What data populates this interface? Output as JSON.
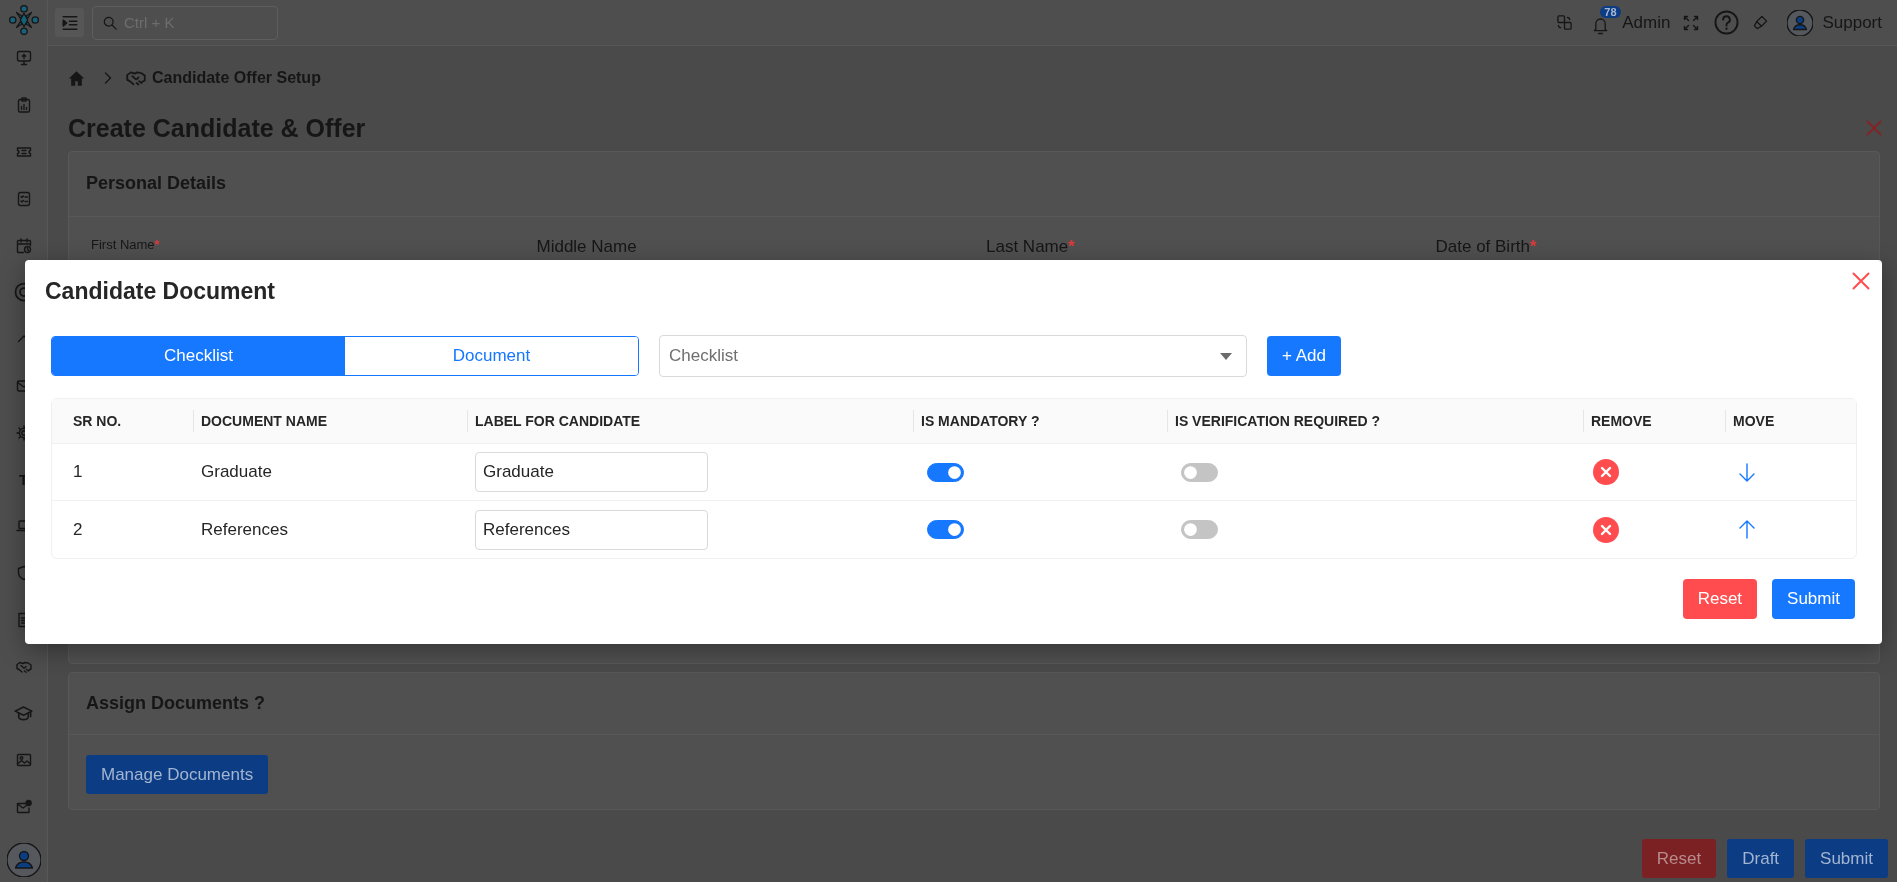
{
  "sidebar": {
    "items": [
      {
        "kind": "icon"
      },
      {
        "kind": "icon"
      },
      {
        "kind": "icon"
      },
      {
        "kind": "icon"
      },
      {
        "kind": "icon"
      },
      {
        "kind": "icon"
      },
      {
        "kind": "icon"
      },
      {
        "kind": "icon"
      },
      {
        "kind": "icon"
      },
      {
        "kind": "letter",
        "text": "T"
      },
      {
        "kind": "icon"
      },
      {
        "kind": "icon"
      },
      {
        "kind": "icon"
      },
      {
        "kind": "icon"
      },
      {
        "kind": "icon"
      },
      {
        "kind": "icon"
      },
      {
        "kind": "icon"
      }
    ]
  },
  "topbar": {
    "search": {
      "placeholder": "Ctrl + K"
    },
    "notification_count": "78",
    "role": "Admin",
    "user": "Support"
  },
  "breadcrumb": {
    "current": "Candidate Offer Setup"
  },
  "page": {
    "title": "Create Candidate & Offer"
  },
  "sections": [
    {
      "title": "Personal Details",
      "fields": [
        {
          "label": "First Name",
          "mark": "*",
          "focused": true
        },
        {
          "label": "Middle Name",
          "focused": false
        },
        {
          "label": "Last Name",
          "mark": "*",
          "focused": false
        },
        {
          "label": "Date of Birth",
          "mark": "*",
          "focused": false
        }
      ]
    },
    {
      "title": "Assign Documents ?",
      "buttons": [
        {
          "label": "Manage Documents",
          "kind": "primary"
        }
      ]
    }
  ],
  "footer_buttons": [
    {
      "label": "Reset",
      "kind": "danger"
    },
    {
      "label": "Draft",
      "kind": "primary"
    },
    {
      "label": "Submit",
      "kind": "primary"
    }
  ],
  "modal": {
    "title": "Candidate Document",
    "tabs": [
      {
        "label": "Checklist",
        "selected": true
      },
      {
        "label": "Document",
        "selected": false
      }
    ],
    "select": {
      "placeholder": "Checklist"
    },
    "add_button": "+ Add",
    "table": {
      "columns": [
        "SR NO.",
        "DOCUMENT NAME",
        "LABEL FOR CANDIDATE",
        "IS MANDATORY ?",
        "IS VERIFICATION REQUIRED ?",
        "REMOVE",
        "MOVE"
      ],
      "rows": [
        {
          "sr_no": "1",
          "document_name": "Graduate",
          "label": "Graduate",
          "mandatory": true,
          "verification_required": false,
          "move_down": true
        },
        {
          "sr_no": "2",
          "document_name": "References",
          "label": "References",
          "mandatory": true,
          "verification_required": false,
          "move_down": false
        }
      ]
    },
    "buttons": [
      {
        "label": "Reset",
        "kind": "danger"
      },
      {
        "label": "Submit",
        "kind": "primary"
      }
    ]
  }
}
